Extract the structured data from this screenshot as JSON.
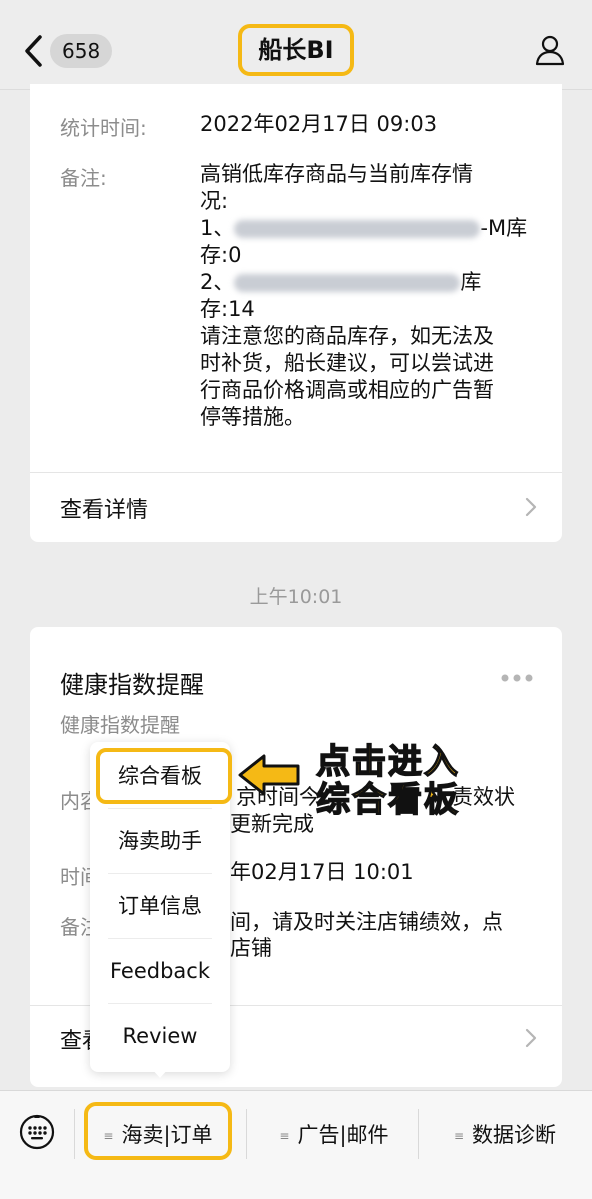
{
  "header": {
    "back_count": "658",
    "title": "船长BI"
  },
  "card1": {
    "stat_time_label": "统计时间:",
    "stat_time_value": "2022年02月17日 09:03",
    "remark_label": "备注:",
    "remark_lines": [
      "高销低库存商品与当前库存情",
      "况:",
      "1、",
      "-M库",
      "存:0",
      "2、",
      "库",
      "存:14",
      "请注意您的商品库存，如无法及",
      "时补货，船长建议，可以尝试进",
      "行商品价格调高或相应的广告暂",
      "停等措施。"
    ],
    "detail_link": "查看详情"
  },
  "timestamp": "上午10:01",
  "card2": {
    "title": "健康指数提醒",
    "subtitle": "健康指数提醒",
    "content_label_fragment": "内容",
    "content_value_line1": "京时间今",
    "content_value_line1b": "责效状",
    "content_value_line2": "更新完成",
    "time_label_fragment": "时间",
    "time_value": "年02月17日 10:01",
    "remark_label_fragment": "备注",
    "remark_line1": "间，请及时关注店铺绩效，点",
    "remark_line2": "店铺",
    "detail_link_fragment": "查看"
  },
  "popup_menu": {
    "items": [
      "综合看板",
      "海卖助手",
      "订单信息",
      "Feedback",
      "Review"
    ]
  },
  "annotation": {
    "line1": "点击进入",
    "line2": "综合看板"
  },
  "bottom_bar": {
    "items": [
      "海卖|订单",
      "广告|邮件",
      "数据诊断"
    ]
  },
  "colors": {
    "highlight": "#f5b915",
    "background": "#ececec"
  }
}
